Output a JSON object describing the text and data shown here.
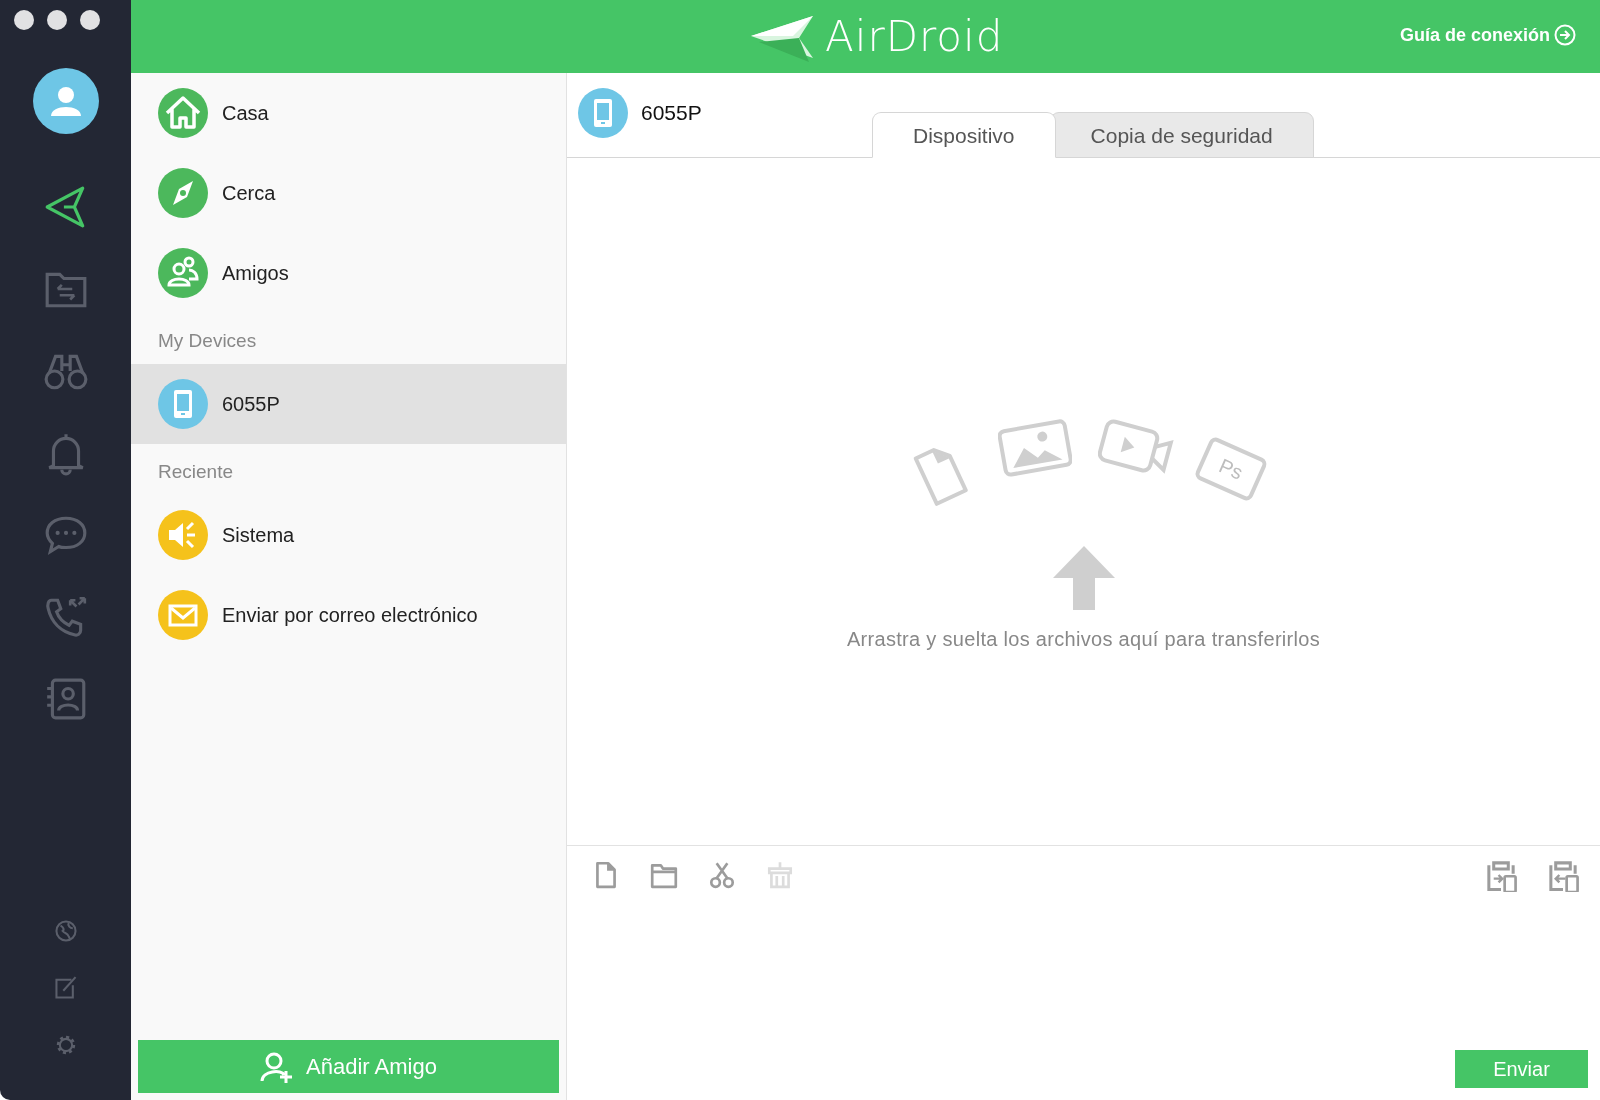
{
  "rail": {
    "top": [
      {
        "selected": true
      },
      {
        "selected": false
      },
      {
        "selected": false
      },
      {
        "selected": false
      },
      {
        "selected": false
      },
      {
        "selected": false
      },
      {
        "selected": false
      }
    ],
    "bottom": [
      {
        "selected": false
      },
      {
        "selected": false
      },
      {
        "selected": false
      }
    ]
  },
  "header": {
    "logo": "AirDroid",
    "link": "Guía de conexión"
  },
  "sidebar": {
    "groups": [
      {
        "items": [
          {
            "label": "Casa",
            "color": "#4cb85c",
            "selected": false
          },
          {
            "label": "Cerca",
            "color": "#4cb85c",
            "selected": false
          },
          {
            "label": "Amigos",
            "color": "#4cb85c",
            "selected": false
          }
        ]
      },
      {
        "heading": "My Devices",
        "items": [
          {
            "label": "6055P",
            "color": "#6ec6e6",
            "selected": true
          }
        ]
      },
      {
        "heading": "Reciente",
        "items": [
          {
            "label": "Sistema",
            "color": "#f5c21b",
            "selected": false
          },
          {
            "label": "Enviar por correo electrónico",
            "color": "#f5c21b",
            "selected": false
          }
        ]
      }
    ],
    "add_button": "Añadir Amigo"
  },
  "device": {
    "name": "6055P",
    "tabs": [
      {
        "label": "Dispositivo",
        "selected": true
      },
      {
        "label": "Copia de seguridad",
        "selected": false
      }
    ]
  },
  "drop_zone": {
    "badge": "Ps",
    "hint": "Arrastra y suelta los archivos aquí para transferirlos"
  },
  "toolbar": {
    "left": [
      {
        "disabled": false
      },
      {
        "disabled": false
      },
      {
        "disabled": false
      },
      {
        "disabled": true
      }
    ],
    "right": [
      {
        "disabled": false
      },
      {
        "disabled": false
      }
    ]
  },
  "send_button": "Enviar"
}
